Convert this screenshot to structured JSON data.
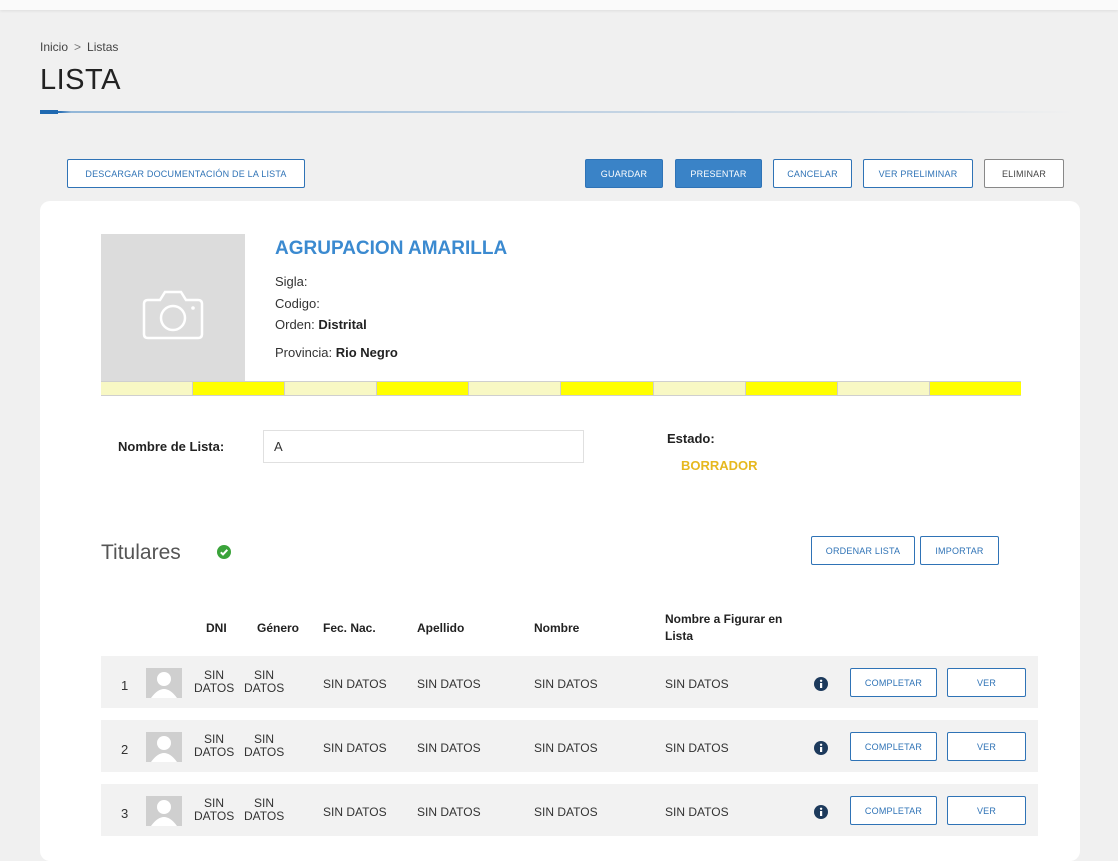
{
  "breadcrumb": {
    "home": "Inicio",
    "separator": ">",
    "current": "Listas"
  },
  "page": {
    "title": "LISTA"
  },
  "toolbar": {
    "download_label": "DESCARGAR DOCUMENTACIÓN DE LA LISTA",
    "save_label": "GUARDAR",
    "submit_label": "PRESENTAR",
    "cancel_label": "CANCELAR",
    "preview_label": "VER PRELIMINAR",
    "delete_label": "ELIMINAR"
  },
  "party": {
    "name": "AGRUPACION AMARILLA",
    "photo_icon": "camera-icon",
    "sigla_label": "Sigla:",
    "sigla_value": "",
    "codigo_label": "Codigo:",
    "codigo_value": "",
    "orden_label": "Orden:",
    "orden_value": "Distrital",
    "provincia_label": "Provincia:",
    "provincia_value": "Rio Negro",
    "stripe_colors": [
      "#f8f8c4",
      "#ffff00"
    ]
  },
  "form": {
    "nombre_label": "Nombre de Lista:",
    "nombre_value": "A",
    "estado_label": "Estado:",
    "estado_value": "BORRADOR"
  },
  "section": {
    "title": "Titulares",
    "status_icon": "check-circle-icon",
    "order_label": "ORDENAR LISTA",
    "import_label": "IMPORTAR"
  },
  "table": {
    "columns": {
      "dni": "DNI",
      "genero": "Género",
      "fec_nac": "Fec. Nac.",
      "apellido": "Apellido",
      "nombre": "Nombre",
      "figurar": "Nombre a Figurar en Lista"
    },
    "rows": [
      {
        "num": "1",
        "dni_a": "SIN",
        "dni_b": "DATOS",
        "gen_a": "SIN",
        "gen_b": "DATOS",
        "fec_nac": "SIN DATOS",
        "apellido": "SIN DATOS",
        "nombre": "SIN DATOS",
        "figurar": "SIN DATOS",
        "complete_label": "COMPLETAR",
        "view_label": "VER"
      },
      {
        "num": "2",
        "dni_a": "SIN",
        "dni_b": "DATOS",
        "gen_a": "SIN",
        "gen_b": "DATOS",
        "fec_nac": "SIN DATOS",
        "apellido": "SIN DATOS",
        "nombre": "SIN DATOS",
        "figurar": "SIN DATOS",
        "complete_label": "COMPLETAR",
        "view_label": "VER"
      },
      {
        "num": "3",
        "dni_a": "SIN",
        "dni_b": "DATOS",
        "gen_a": "SIN",
        "gen_b": "DATOS",
        "fec_nac": "SIN DATOS",
        "apellido": "SIN DATOS",
        "nombre": "SIN DATOS",
        "figurar": "SIN DATOS",
        "complete_label": "COMPLETAR",
        "view_label": "VER"
      }
    ]
  },
  "colors": {
    "primary": "#2f73b6",
    "party_name": "#3b8ad0",
    "estado": "#e6b81f",
    "check": "#3aa33a",
    "info_icon": "#1d3a5c"
  }
}
